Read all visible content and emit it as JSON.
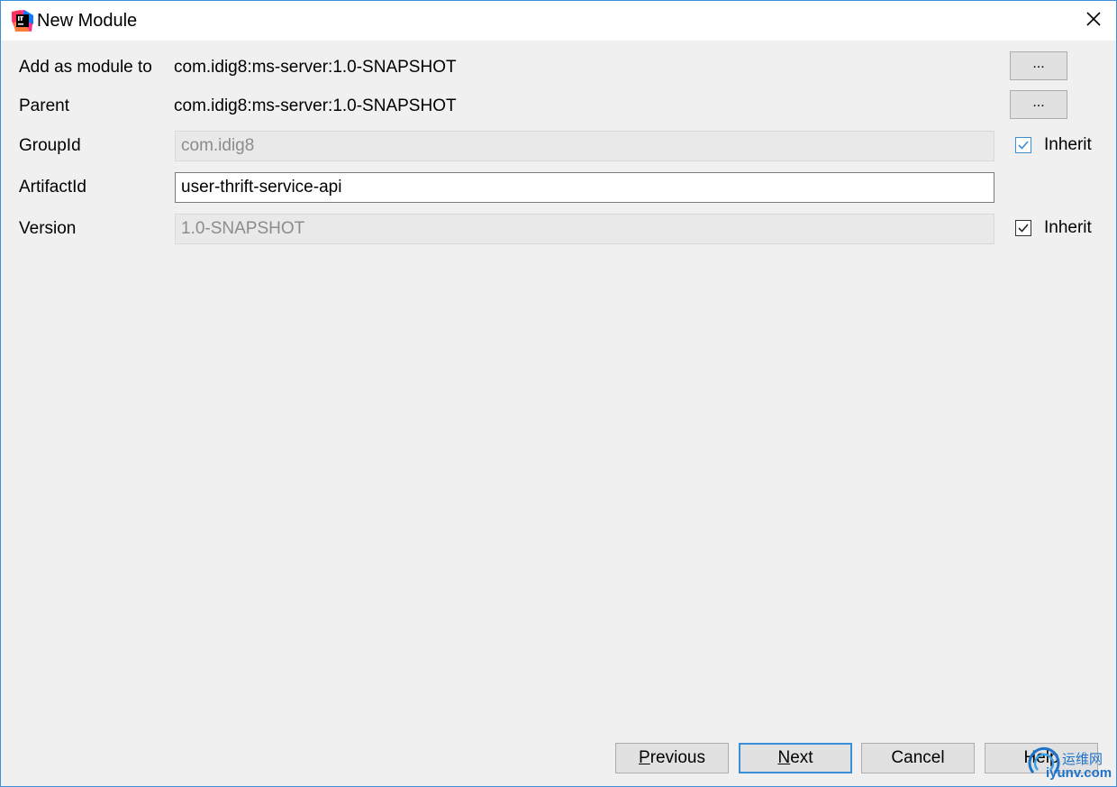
{
  "window": {
    "title": "New Module",
    "app_icon": "intellij-idea-icon",
    "close_icon": "close-icon"
  },
  "form": {
    "add_as_module_to": {
      "label": "Add as module to",
      "value": "com.idig8:ms-server:1.0-SNAPSHOT",
      "browse_label": "..."
    },
    "parent": {
      "label": "Parent",
      "value": "com.idig8:ms-server:1.0-SNAPSHOT",
      "browse_label": "..."
    },
    "group_id": {
      "label": "GroupId",
      "value": "com.idig8",
      "inherit_label": "Inherit",
      "inherit_checked": true
    },
    "artifact_id": {
      "label": "ArtifactId",
      "value": "user-thrift-service-api"
    },
    "version": {
      "label": "Version",
      "value": "1.0-SNAPSHOT",
      "inherit_label": "Inherit",
      "inherit_checked": true
    }
  },
  "footer": {
    "previous_mnemonic": "P",
    "previous_rest": "revious",
    "next_mnemonic": "N",
    "next_rest": "ext",
    "cancel_label": "Cancel",
    "help_label": "Help"
  },
  "watermark": {
    "chinese": "运维网",
    "domain": "iyunv.com"
  },
  "colors": {
    "accent": "#3a8fd6",
    "background": "#f0f0f0",
    "disabled_field": "#e9e9e9",
    "watermark": "#1e73c8"
  }
}
